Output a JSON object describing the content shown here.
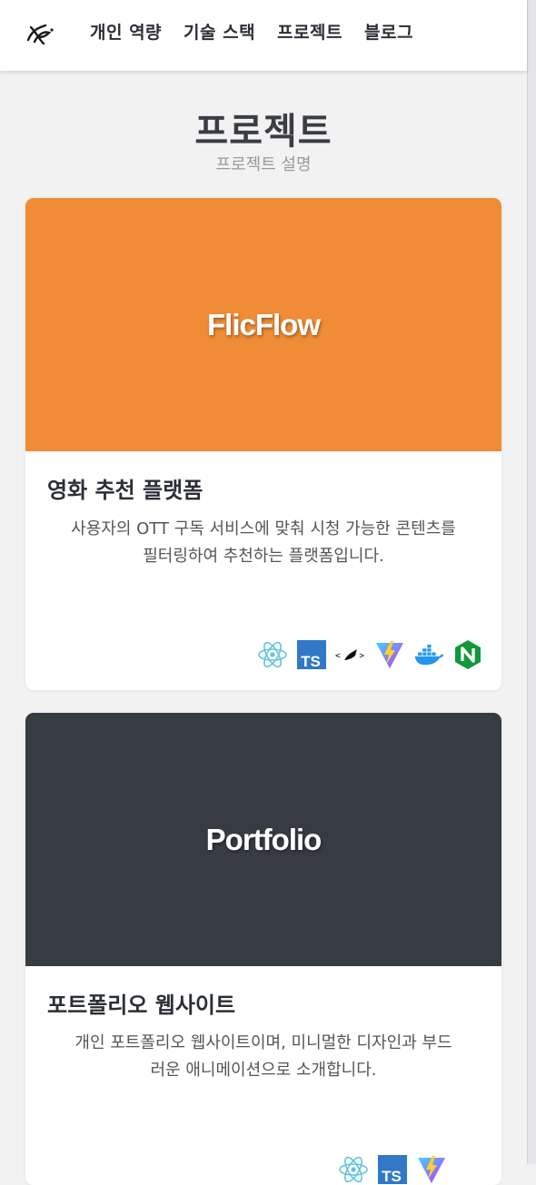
{
  "nav": {
    "items": [
      {
        "label": "개인 역량"
      },
      {
        "label": "기술 스택"
      },
      {
        "label": "프로젝트"
      },
      {
        "label": "블로그"
      }
    ]
  },
  "section": {
    "title": "프로젝트",
    "subtitle": "프로젝트 설명"
  },
  "projects": [
    {
      "banner_text": "FlicFlow",
      "banner_color": "#ef8c35",
      "title": "영화 추천 플랫폼",
      "desc_line1": "사용자의 OTT 구독 서비스에 맞춰 시청 가능한 콘텐츠를",
      "desc_line2": "필터링하여 추천하는 플랫폼입니다.",
      "tech_icons": [
        "react-icon",
        "typescript-icon",
        "styled-components-icon",
        "vite-icon",
        "docker-icon",
        "nginx-icon"
      ]
    },
    {
      "banner_text": "Portfolio",
      "banner_color": "#373b42",
      "title": "포트폴리오 웹사이트",
      "desc_line1": "개인 포트폴리오 웹사이트이며, 미니멀한 디자인과 부드",
      "desc_line2": "러운 애니메이션으로 소개합니다.",
      "tech_icons": [
        "react-icon",
        "typescript-icon",
        "vite-icon"
      ]
    }
  ]
}
